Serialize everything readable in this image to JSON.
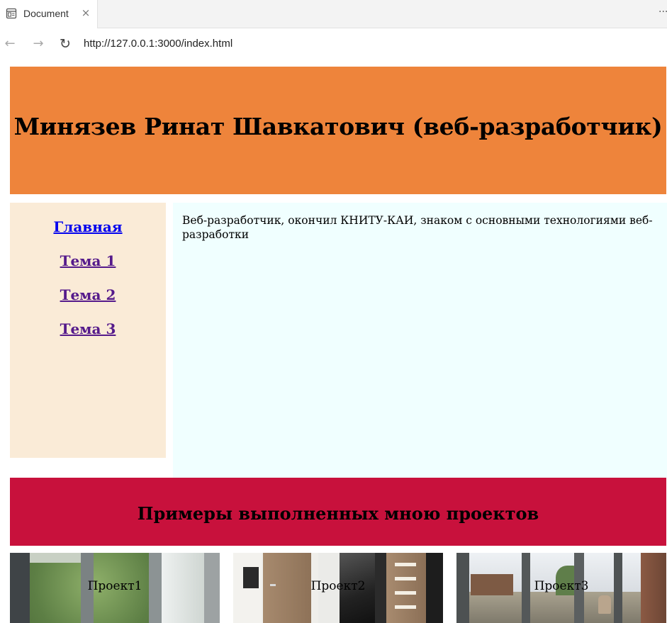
{
  "browser": {
    "tab_title": "Document",
    "tab_close_icon": "×",
    "more_icon": "···",
    "back_icon": "←",
    "forward_icon": "→",
    "reload_icon": "↻",
    "url": "http://127.0.0.1:3000/index.html"
  },
  "header": {
    "title": "Минязев Ринат Шавкатович (веб-разработчик)"
  },
  "sidebar": {
    "items": [
      {
        "label": "Главная"
      },
      {
        "label": "Тема 1"
      },
      {
        "label": "Тема 2"
      },
      {
        "label": "Тема 3"
      }
    ]
  },
  "content": {
    "text": "Веб-разработчик, окончил КНИТУ-КАИ, знаком с основными технологиями веб-разработки"
  },
  "projects": {
    "title": "Примеры выполненных мною проектов",
    "items": [
      {
        "label": "Проект1"
      },
      {
        "label": "Проект2"
      },
      {
        "label": "Проект3"
      }
    ]
  },
  "colors": {
    "header_bg": "#ee843b",
    "sidebar_bg": "#faebd7",
    "content_bg": "#f0ffff",
    "projects_header_bg": "#c8113c",
    "link_visited": "#551a8b",
    "link": "#0000ee"
  }
}
